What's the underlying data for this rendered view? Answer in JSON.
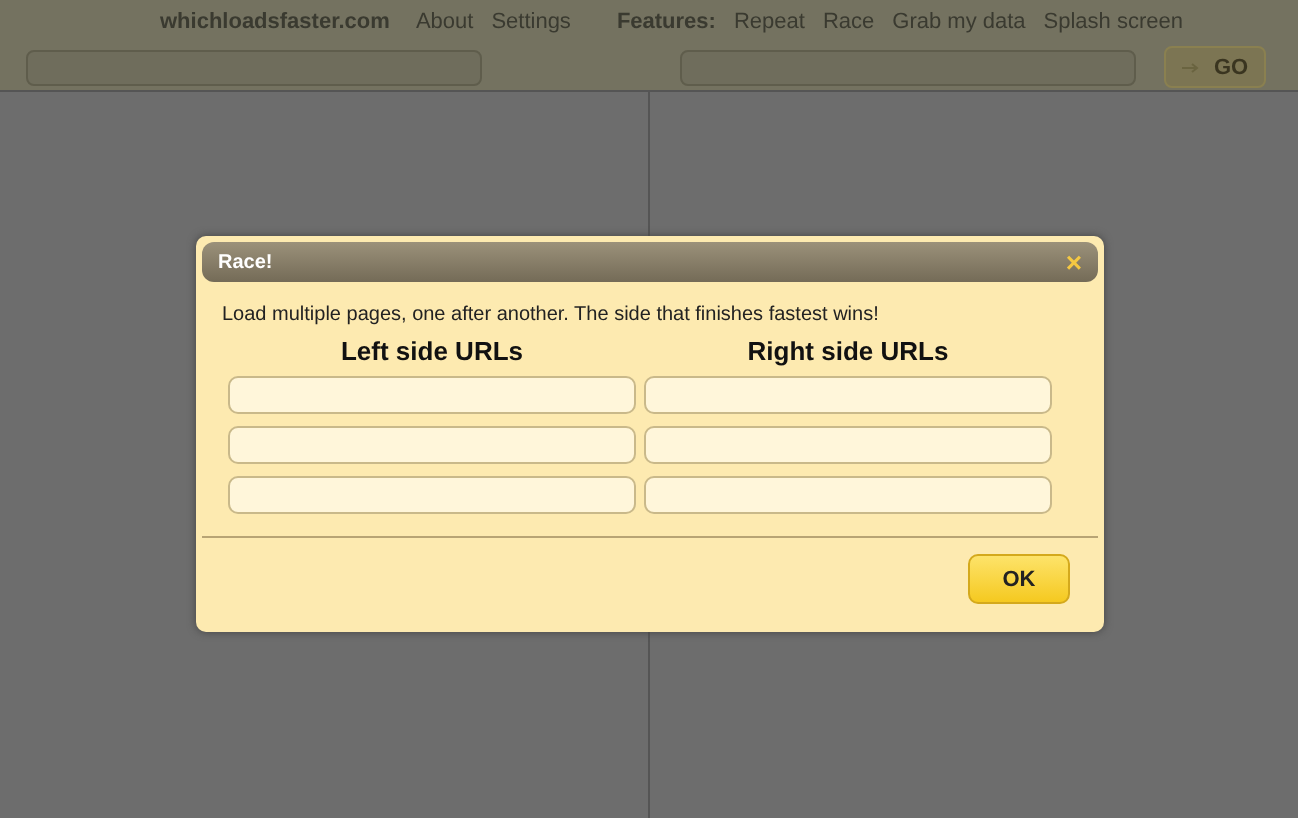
{
  "header": {
    "site": "whichloadsfaster.com",
    "links": [
      {
        "label": "About"
      },
      {
        "label": "Settings"
      }
    ],
    "features_label": "Features:",
    "features": [
      {
        "label": "Repeat"
      },
      {
        "label": "Race"
      },
      {
        "label": "Grab my data"
      },
      {
        "label": "Splash screen"
      }
    ],
    "go_button": "GO"
  },
  "dialog": {
    "title": "Race!",
    "close": "×",
    "description": "Load multiple pages, one after another. The side that finishes fastest wins!",
    "left_heading": "Left side URLs",
    "right_heading": "Right side URLs",
    "ok_button": "OK"
  }
}
